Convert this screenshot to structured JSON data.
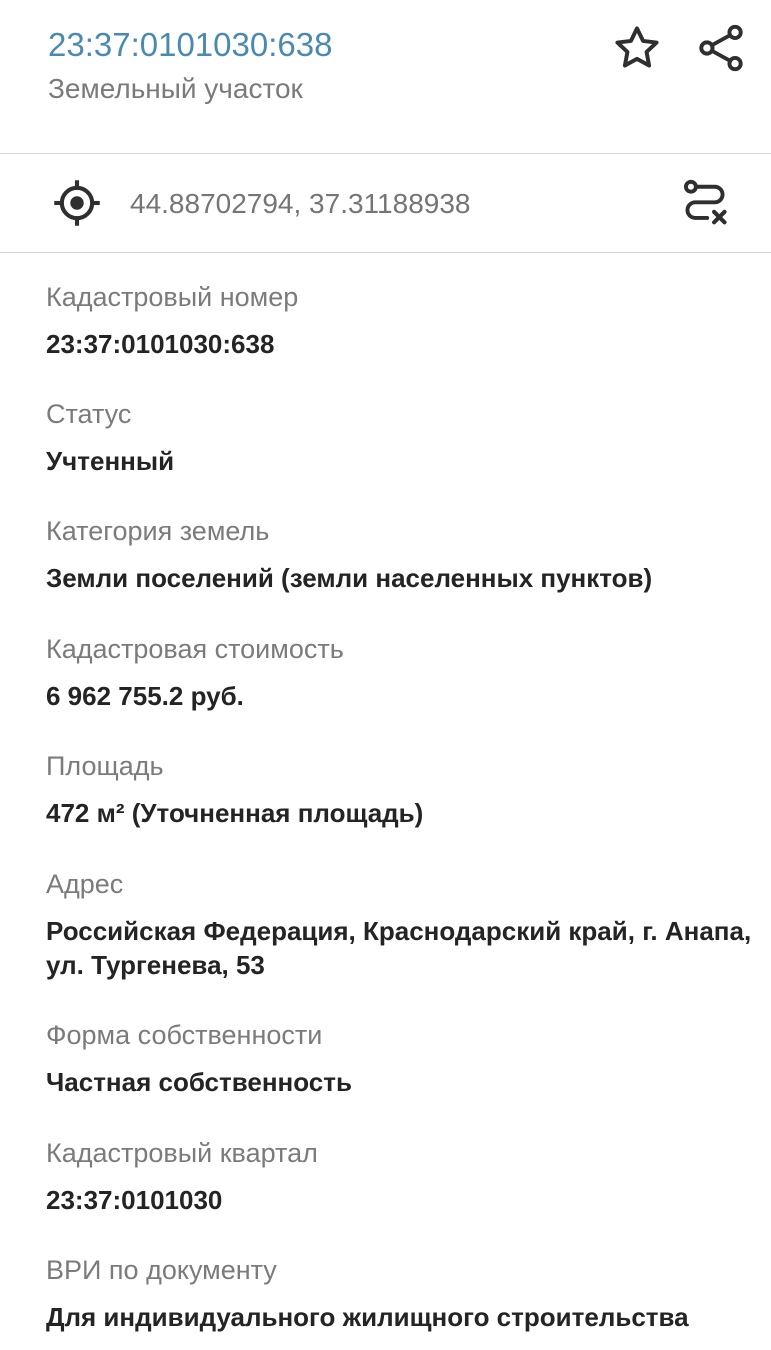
{
  "header": {
    "title": "23:37:0101030:638",
    "subtitle": "Земельный участок",
    "actions": [
      {
        "icon": "star-icon"
      },
      {
        "icon": "share-icon"
      }
    ]
  },
  "coordinates": {
    "icon": "crosshair-icon",
    "text": "44.88702794, 37.31188938",
    "action_icon": "route-clear-icon"
  },
  "fields": [
    {
      "label": "Кадастровый номер",
      "value": "23:37:0101030:638"
    },
    {
      "label": "Статус",
      "value": "Учтенный"
    },
    {
      "label": "Категория земель",
      "value": "Земли поселений (земли населенных пунктов)"
    },
    {
      "label": "Кадастровая стоимость",
      "value": "6 962 755.2 руб."
    },
    {
      "label": "Площадь",
      "value": "472 м² (Уточненная площадь)"
    },
    {
      "label": "Адрес",
      "value_lines": [
        "Российская Федерация, Краснодарский край, г. Анапа,",
        "ул. Тургенева, 53"
      ]
    },
    {
      "label": "Форма собственности",
      "value": "Частная собственность"
    },
    {
      "label": "Кадастровый квартал",
      "value": "23:37:0101030"
    },
    {
      "label": "ВРИ по документу",
      "value": "Для индивидуального жилищного строительства"
    }
  ],
  "colors": {
    "accent": "#4a8ab0",
    "label": "#7b7b7b",
    "value": "#242424",
    "divider": "#d4d4d4"
  }
}
